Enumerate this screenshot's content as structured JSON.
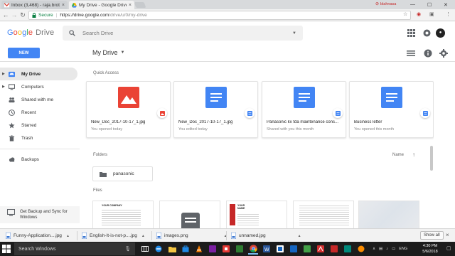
{
  "browser": {
    "tabs": [
      {
        "title": "Inbox (3,468) - raja.broth",
        "active": false
      },
      {
        "title": "My Drive - Google Drive",
        "active": true
      }
    ],
    "url_secure_label": "Secure",
    "url_host": "https://drive.google.com",
    "url_path": "/drive/u/0/my-drive",
    "profile_label": "blahnasa"
  },
  "drive": {
    "logo_word": "Drive",
    "search_placeholder": "Search Drive",
    "new_button": "NEW",
    "breadcrumb": "My Drive",
    "sidebar": [
      {
        "label": "My Drive",
        "selected": true,
        "icon": "drive-icon"
      },
      {
        "label": "Computers",
        "selected": false,
        "icon": "computer-icon"
      },
      {
        "label": "Shared with me",
        "selected": false,
        "icon": "people-icon"
      },
      {
        "label": "Recent",
        "selected": false,
        "icon": "clock-icon"
      },
      {
        "label": "Starred",
        "selected": false,
        "icon": "star-icon"
      },
      {
        "label": "Trash",
        "selected": false,
        "icon": "trash-icon"
      },
      {
        "label": "Backups",
        "selected": false,
        "icon": "cloud-icon"
      }
    ],
    "backup_promo": {
      "line1": "Get Backup and Sync for",
      "line2": "Windows"
    },
    "quick_access_label": "Quick Access",
    "quick_access": [
      {
        "name": "New_Doc_2017-10-17_1.jpg",
        "subtitle": "You opened today",
        "type": "image"
      },
      {
        "name": "New_Doc_2017-10-17_1.jpg",
        "subtitle": "You edited today",
        "type": "doc"
      },
      {
        "name": "Panasonic kx tda maintenance cons...",
        "subtitle": "Shared with you this month",
        "type": "doc"
      },
      {
        "name": "Business letter",
        "subtitle": "You opened this month",
        "type": "doc"
      }
    ],
    "folders_label": "Folders",
    "sort_label": "Name",
    "folders": [
      {
        "name": "panasonic"
      }
    ],
    "files_label": "Files",
    "file_previews": [
      {
        "header": "YOUR COMPANY"
      },
      {
        "header": ""
      },
      {
        "header": "YOUR NAME"
      },
      {
        "header": ""
      },
      {
        "header": ""
      }
    ]
  },
  "downloads": {
    "items": [
      "Funny-Application....jpg",
      "English-It-is-not-p....jpg",
      "images.png",
      "unnamed.jpg"
    ],
    "show_all": "Show all"
  },
  "taskbar": {
    "search_placeholder": "Search Windows",
    "time": "4:30 PM",
    "date": "5/6/2018",
    "language": "ENG"
  },
  "colors": {
    "drive_blue": "#4285f4",
    "image_red": "#ea4335",
    "secure_green": "#0b8043"
  }
}
